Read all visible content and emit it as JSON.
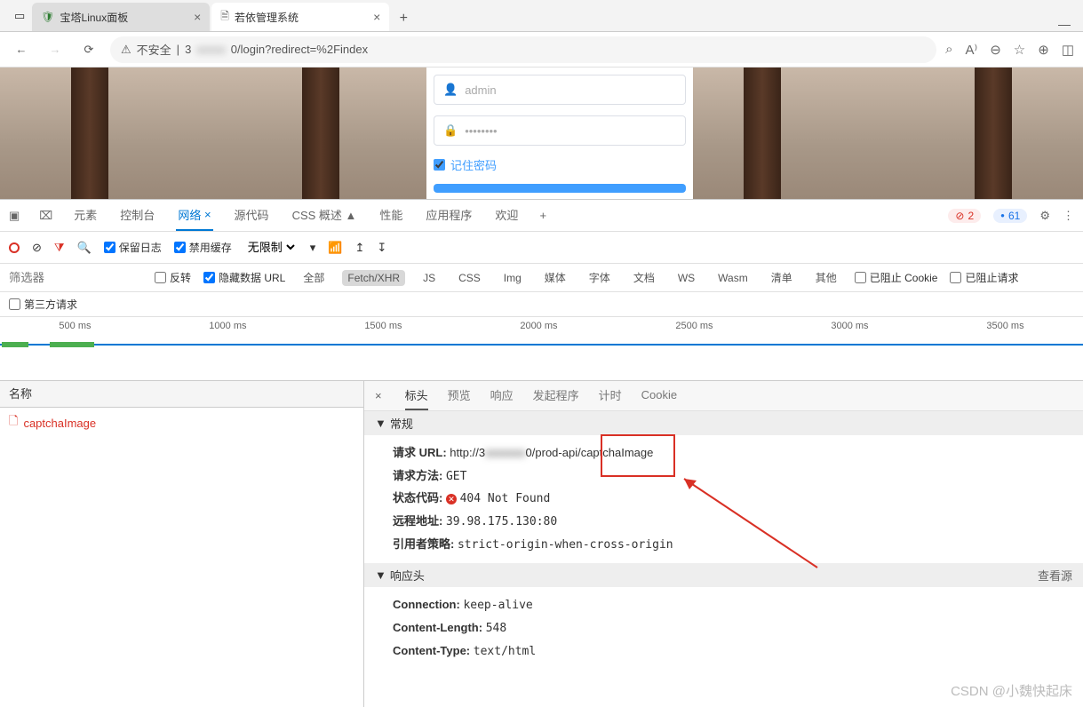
{
  "browser": {
    "tabs": [
      {
        "title": "宝塔Linux面板",
        "icon": "🛡"
      },
      {
        "title": "若依管理系统",
        "icon": "🗎"
      }
    ],
    "url_insecure": "不安全",
    "url_prefix": "3",
    "url_suffix": "0/login?redirect=%2Findex"
  },
  "login": {
    "username": "admin",
    "password": "••••••••",
    "remember": "记住密码"
  },
  "devtools": {
    "tabs": [
      "元素",
      "控制台",
      "网络",
      "源代码",
      "CSS 概述 ▲",
      "性能",
      "应用程序",
      "欢迎"
    ],
    "active_tab": 2,
    "close_x": "×",
    "add": "+",
    "err_count": "2",
    "info_count": "61",
    "toolbar": {
      "preserve_log": "保留日志",
      "disable_cache": "禁用缓存",
      "throttle": "无限制"
    },
    "filter": {
      "placeholder": "筛选器",
      "invert": "反转",
      "hide_data": "隐藏数据 URL",
      "types": [
        "全部",
        "Fetch/XHR",
        "JS",
        "CSS",
        "Img",
        "媒体",
        "字体",
        "文档",
        "WS",
        "Wasm",
        "清单",
        "其他"
      ],
      "active_type": 1,
      "blocked_cookie": "已阻止 Cookie",
      "blocked_req": "已阻止请求"
    },
    "third_party": "第三方请求",
    "timeline_ticks": [
      "500 ms",
      "1000 ms",
      "1500 ms",
      "2000 ms",
      "2500 ms",
      "3000 ms",
      "3500 ms"
    ]
  },
  "network": {
    "name_header": "名称",
    "requests": [
      {
        "name": "captchaImage"
      }
    ]
  },
  "detail": {
    "tabs": [
      "标头",
      "预览",
      "响应",
      "发起程序",
      "计时",
      "Cookie"
    ],
    "active_tab": 0,
    "general_title": "常规",
    "general": {
      "url_label": "请求 URL:",
      "url_prefix": "http://3",
      "url_mid": "0",
      "url_suffix": "/prod-api/captchaImage",
      "method_label": "请求方法:",
      "method": "GET",
      "status_label": "状态代码:",
      "status": "404 Not Found",
      "remote_label": "远程地址:",
      "remote": "39.98.175.130:80",
      "referrer_label": "引用者策略:",
      "referrer": "strict-origin-when-cross-origin"
    },
    "response_headers_title": "响应头",
    "view_source": "查看源",
    "response_headers": [
      {
        "k": "Connection:",
        "v": "keep-alive"
      },
      {
        "k": "Content-Length:",
        "v": "548"
      },
      {
        "k": "Content-Type:",
        "v": "text/html"
      }
    ]
  },
  "watermark": "CSDN @小魏快起床"
}
